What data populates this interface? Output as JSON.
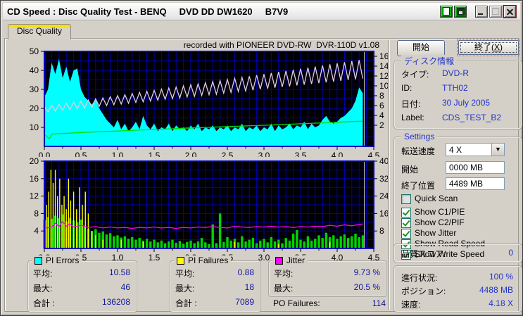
{
  "window": {
    "title": "CD Speed : Disc Quality Test - BENQ     DVD DD DW1620     B7V9"
  },
  "tab": {
    "label": "Disc Quality"
  },
  "recorded_note": "recorded with PIONEER DVD-RW  DVR-110D v1.08",
  "buttons": {
    "start": "開始",
    "stop_prefix": "終了(",
    "stop_key": "X",
    "stop_suffix": ")"
  },
  "disc_info": {
    "title": "ディスク情報",
    "rows": [
      {
        "label": "タイプ:",
        "value": "DVD-R"
      },
      {
        "label": "ID:",
        "value": "TTH02"
      },
      {
        "label": "日付:",
        "value": "30 July 2005"
      },
      {
        "label": "Label:",
        "value": "CDS_TEST_B2"
      }
    ]
  },
  "settings": {
    "title": "Settings",
    "speed_label": "転送速度",
    "speed_value": "4 X",
    "start_label": "開始",
    "start_value": "0000 MB",
    "end_label": "終了位置",
    "end_value": "4489 MB",
    "checkboxes": [
      {
        "label": "Quick Scan",
        "checked": false
      },
      {
        "label": "Show C1/PIE",
        "checked": true
      },
      {
        "label": "Show C2/PIF",
        "checked": true
      },
      {
        "label": "Show Jitter",
        "checked": true
      },
      {
        "label": "Show Read Speed",
        "checked": true
      },
      {
        "label": "Show Write Speed",
        "checked": true
      }
    ]
  },
  "quality": {
    "label": "品質スコア:",
    "value": "0"
  },
  "progress": {
    "rows": [
      {
        "label": "進行状況:",
        "value": "100 %"
      },
      {
        "label": "ポジション:",
        "value": "4488 MB"
      },
      {
        "label": "速度:",
        "value": "4.18 X"
      }
    ]
  },
  "stats": {
    "pi_errors": {
      "title": "PI Errors",
      "swatch": "#00ffff",
      "rows": [
        {
          "label": "平均:",
          "value": "10.58"
        },
        {
          "label": "最大:",
          "value": "46"
        },
        {
          "label": "合計 :",
          "value": "136208"
        }
      ]
    },
    "pi_failures": {
      "title": "PI Failures",
      "swatch": "#ffff00",
      "rows": [
        {
          "label": "平均:",
          "value": "0.88"
        },
        {
          "label": "最大:",
          "value": "18"
        },
        {
          "label": "合計 :",
          "value": "7089"
        }
      ]
    },
    "jitter": {
      "title": "Jitter",
      "swatch": "#ff00ff",
      "rows": [
        {
          "label": "平均:",
          "value": "9.73 %"
        },
        {
          "label": "最大:",
          "value": "20.5 %"
        }
      ]
    },
    "po_failures": {
      "label": "PO Failures:",
      "value": "114"
    }
  },
  "chart_data": [
    {
      "type": "area",
      "name": "pi-errors-vs-speed",
      "x_range": [
        0,
        4.5
      ],
      "x_grid": 0.1,
      "x_ticks": [
        "0.0",
        "0.5",
        "1.0",
        "1.5",
        "2.0",
        "2.5",
        "3.0",
        "3.5",
        "4.0",
        "4.5"
      ],
      "grid_color": "#0000b0",
      "y_left": {
        "range": [
          0,
          50
        ],
        "ticks": [
          10,
          20,
          30,
          40,
          50
        ],
        "grid_step": 5
      },
      "y_right": {
        "mode": "offset",
        "ticks": [
          16,
          14,
          12,
          10,
          8,
          6,
          4,
          2
        ],
        "top": 7,
        "spacing": 14
      },
      "series": [
        {
          "name": "pi-errors-area",
          "type": "area",
          "color": "#00ffff",
          "x0": 0,
          "dx": 0.05,
          "values": [
            26,
            30,
            44,
            38,
            46,
            36,
            42,
            34,
            40,
            41,
            30,
            26,
            24,
            22,
            25,
            20,
            17,
            14,
            12,
            10,
            14,
            9,
            12,
            8,
            10,
            13,
            9,
            16,
            11,
            9,
            12,
            8,
            10,
            9,
            12,
            8,
            11,
            9,
            10,
            8,
            11,
            9,
            12,
            8,
            10,
            9,
            11,
            8,
            10,
            9,
            11,
            8,
            10,
            9,
            12,
            8,
            10,
            9,
            11,
            8,
            10,
            9,
            12,
            8,
            11,
            9,
            10,
            12,
            9,
            11,
            10,
            13,
            9,
            12,
            10,
            11,
            14,
            16,
            13,
            12,
            13,
            15,
            16,
            18,
            20,
            24,
            31,
            28
          ]
        },
        {
          "name": "read-speed-line",
          "type": "line",
          "color": "#00e000",
          "points": [
            [
              0,
              6.3
            ],
            [
              0.07,
              4.0
            ],
            [
              0.1,
              6.5
            ],
            [
              0.5,
              7.3
            ],
            [
              1.0,
              8.1
            ],
            [
              1.5,
              8.9
            ],
            [
              2.0,
              9.7
            ],
            [
              2.5,
              10.4
            ],
            [
              3.0,
              11.1
            ],
            [
              3.5,
              11.9
            ],
            [
              4.0,
              12.7
            ],
            [
              4.35,
              13.3
            ]
          ]
        },
        {
          "name": "write-speed-line",
          "type": "line",
          "color": "#e2cbe2",
          "x0": 0,
          "dx": 0.05,
          "values": [
            21.0,
            18.2,
            21.6,
            18.6,
            22.1,
            19.0,
            22.7,
            19.4,
            23.3,
            19.8,
            23.8,
            20.2,
            24.4,
            20.7,
            25.0,
            21.1,
            25.5,
            21.5,
            26.1,
            21.9,
            26.7,
            22.3,
            27.2,
            22.7,
            27.8,
            23.1,
            28.4,
            23.5,
            29.0,
            23.9,
            29.5,
            24.3,
            30.1,
            24.8,
            30.7,
            25.1,
            31.2,
            25.5,
            31.8,
            26.0,
            32.4,
            26.3,
            32.9,
            26.8,
            33.5,
            27.2,
            34.1,
            27.5,
            34.6,
            28.0,
            35.2,
            28.4,
            35.8,
            28.9,
            36.3,
            29.2,
            36.9,
            29.6,
            37.5,
            30.1,
            38.0,
            30.4,
            38.6,
            30.9,
            39.2,
            31.3,
            39.7,
            31.6,
            40.3,
            32.1,
            40.9,
            32.5,
            41.4,
            32.9,
            42.0,
            33.3,
            42.6,
            33.7,
            43.2,
            34.1,
            43.7,
            34.5,
            44.3,
            35.0,
            44.9,
            35.3,
            45.4,
            35.7
          ]
        },
        {
          "name": "position-cursor",
          "type": "vline",
          "color": "#c0c0c0",
          "x": 4.37
        }
      ]
    },
    {
      "type": "bar",
      "name": "pif-jitter",
      "x_range": [
        0,
        4.5
      ],
      "x_grid": 0.1,
      "x_ticks": [
        "0.0",
        "0.5",
        "1.0",
        "1.5",
        "2.0",
        "2.5",
        "3.0",
        "3.5",
        "4.0",
        "4.5"
      ],
      "grid_color": "#0000b0",
      "y_left": {
        "range": [
          0,
          20
        ],
        "ticks": [
          4,
          8,
          12,
          16,
          20
        ],
        "grid_step": 2
      },
      "y_right": {
        "mode": "range",
        "range": [
          0,
          40
        ],
        "ticks": [
          8,
          16,
          24,
          32,
          40
        ]
      },
      "series": [
        {
          "name": "pie-green-bars",
          "type": "bars",
          "color": "#00d400",
          "x0": 0,
          "dx": 0.05,
          "barw": 3.4,
          "values": [
            6.5,
            7.2,
            6.8,
            7.5,
            6.9,
            7.8,
            6.2,
            7.0,
            6.4,
            6.0,
            6.6,
            5.2,
            4.5,
            4.0,
            4.4,
            3.6,
            3.9,
            3.2,
            3.5,
            2.8,
            3.0,
            2.5,
            2.8,
            2.2,
            2.6,
            2.0,
            2.4,
            1.8,
            2.2,
            1.6,
            2.0,
            1.4,
            1.8,
            1.2,
            1.6,
            2.0,
            1.3,
            1.7,
            1.1,
            1.5,
            1.8,
            1.2,
            1.6,
            2.4,
            1.4,
            1.0,
            5.5,
            1.2,
            8.0,
            1.5,
            2.6,
            1.8,
            2.2,
            1.4,
            2.8,
            1.6,
            2.0,
            2.4,
            1.2,
            1.8,
            2.2,
            1.4,
            2.6,
            1.6,
            2.0,
            1.2,
            2.4,
            1.8,
            3.4,
            4.2,
            2.0,
            1.6,
            2.8,
            1.8,
            2.2,
            3.0,
            2.4,
            3.6,
            2.6,
            3.0,
            2.2,
            2.8,
            3.2,
            2.4,
            2.8,
            3.4,
            2.6,
            3.0
          ]
        },
        {
          "name": "pi-failures-spikes",
          "type": "spikes",
          "color": "#ffff00",
          "points": [
            [
              0.03,
              10
            ],
            [
              0.06,
              13
            ],
            [
              0.09,
              18
            ],
            [
              0.12,
              15
            ],
            [
              0.15,
              18
            ],
            [
              0.18,
              12
            ],
            [
              0.21,
              16
            ],
            [
              0.24,
              10
            ],
            [
              0.27,
              12
            ],
            [
              0.3,
              9
            ],
            [
              0.33,
              16
            ],
            [
              0.36,
              11
            ],
            [
              0.4,
              13
            ],
            [
              0.44,
              9
            ],
            [
              0.48,
              14
            ],
            [
              0.52,
              10
            ],
            [
              0.56,
              13
            ],
            [
              0.6,
              8
            ],
            [
              0.65,
              4
            ],
            [
              0.7,
              3
            ],
            [
              0.8,
              2
            ],
            [
              1.05,
              2
            ],
            [
              1.35,
              1.5
            ],
            [
              2.6,
              1.5
            ],
            [
              3.2,
              1
            ],
            [
              3.9,
              1.5
            ]
          ]
        },
        {
          "name": "jitter-line",
          "type": "line",
          "color": "#ff00ff",
          "points": [
            [
              0,
              4.6
            ],
            [
              0.1,
              4.9
            ],
            [
              0.15,
              5.8
            ],
            [
              0.2,
              5.0
            ],
            [
              0.25,
              6.2
            ],
            [
              0.3,
              5.1
            ],
            [
              0.35,
              5.6
            ],
            [
              0.4,
              4.9
            ],
            [
              0.5,
              5.3
            ],
            [
              0.6,
              4.8
            ],
            [
              0.7,
              5.0
            ],
            [
              0.8,
              4.7
            ],
            [
              0.9,
              4.9
            ],
            [
              1.0,
              4.7
            ],
            [
              1.1,
              4.8
            ],
            [
              1.2,
              4.6
            ],
            [
              1.3,
              4.8
            ],
            [
              1.4,
              4.7
            ],
            [
              1.5,
              4.9
            ],
            [
              1.6,
              4.7
            ],
            [
              1.7,
              4.8
            ],
            [
              1.8,
              4.6
            ],
            [
              1.9,
              4.8
            ],
            [
              2.0,
              4.7
            ],
            [
              2.1,
              4.9
            ],
            [
              2.2,
              4.8
            ],
            [
              2.3,
              5.0
            ],
            [
              2.4,
              4.8
            ],
            [
              2.5,
              4.7
            ],
            [
              2.6,
              5.1
            ],
            [
              2.7,
              4.9
            ],
            [
              2.8,
              4.8
            ],
            [
              2.9,
              5.0
            ],
            [
              3.0,
              4.9
            ],
            [
              3.1,
              5.1
            ],
            [
              3.2,
              4.9
            ],
            [
              3.3,
              5.0
            ],
            [
              3.4,
              4.8
            ],
            [
              3.5,
              5.0
            ],
            [
              3.6,
              4.9
            ],
            [
              3.7,
              5.1
            ],
            [
              3.8,
              5.0
            ],
            [
              3.9,
              5.3
            ],
            [
              4.0,
              5.1
            ],
            [
              4.1,
              5.4
            ],
            [
              4.2,
              5.2
            ],
            [
              4.3,
              5.5
            ],
            [
              4.35,
              5.6
            ]
          ]
        },
        {
          "name": "position-cursor",
          "type": "vline",
          "color": "#c0c0c0",
          "x": 4.37
        }
      ]
    }
  ]
}
